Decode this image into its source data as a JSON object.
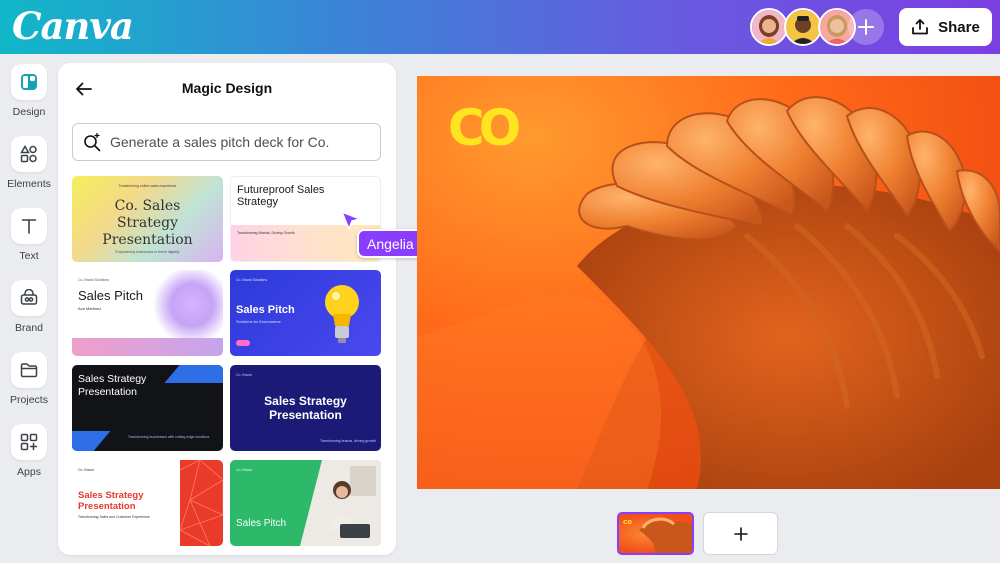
{
  "app": {
    "logo_text": "Canva",
    "share_label": "Share"
  },
  "collaborators": [
    {
      "name": "avatar-1",
      "color": "#f2b6c9"
    },
    {
      "name": "avatar-2",
      "color": "#f4c542"
    },
    {
      "name": "avatar-3",
      "color": "#f7a7a0"
    }
  ],
  "rail": {
    "items": [
      {
        "label": "Design",
        "icon": "design-icon"
      },
      {
        "label": "Elements",
        "icon": "elements-icon"
      },
      {
        "label": "Text",
        "icon": "text-icon"
      },
      {
        "label": "Brand",
        "icon": "brand-icon"
      },
      {
        "label": "Projects",
        "icon": "folder-icon"
      },
      {
        "label": "Apps",
        "icon": "apps-icon"
      }
    ]
  },
  "panel": {
    "title": "Magic Design",
    "search": {
      "value": "",
      "placeholder": "Generate a sales pitch deck for Co."
    },
    "templates": [
      {
        "title": "Co. Sales Strategy Presentation",
        "small_top": "Transforming online sales experience",
        "small_bottom": "Empowering businesses to thrive digitally"
      },
      {
        "title": "Futureproof Sales Strategy",
        "small_top": "",
        "small_bottom": "Transforming Brands, Driving Growth"
      },
      {
        "title": "Sales Pitch",
        "subtitle": "Ava Martinez",
        "small_top": "Co. Brand Solutions"
      },
      {
        "title": "Sales Pitch",
        "subtitle": "Solutions for Ecommerce",
        "small_top": "Co. Brand Solutions"
      },
      {
        "title": "Sales Strategy Presentation",
        "small_bottom": "Transforming businesses with cutting-edge solutions"
      },
      {
        "title": "Sales Strategy Presentation",
        "small_top": "Co. Brand",
        "small_bottom": "Transforming brands, driving growth"
      },
      {
        "title": "Sales Strategy Presentation",
        "subtitle": "Transforming Sales and Customer Experience",
        "small_top": "Co. Brand"
      },
      {
        "title": "Sales Pitch",
        "small_top": "Co. Brand"
      }
    ]
  },
  "cursor": {
    "user": "Angelia",
    "color": "#8b3dff"
  },
  "canvas": {
    "logo_text": "CO",
    "logo_color": "#ffe51f",
    "accent": "#ff6a1a"
  },
  "pages": {
    "current": 1,
    "add_label": "+"
  }
}
